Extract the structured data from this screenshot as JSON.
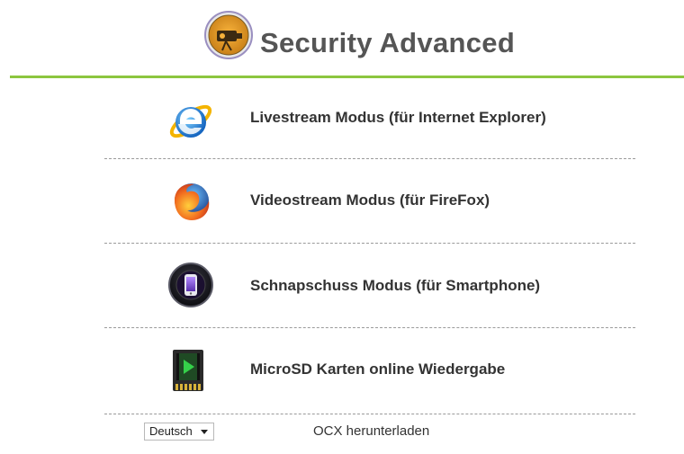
{
  "header": {
    "title": "Security Advanced",
    "logo_icon": "camera-logo-icon"
  },
  "menu": {
    "items": [
      {
        "label": "Livestream Modus (für Internet Explorer)",
        "icon": "internet-explorer-icon"
      },
      {
        "label": "Videostream Modus (für FireFox)",
        "icon": "firefox-icon"
      },
      {
        "label": "Schnapschuss Modus (für Smartphone)",
        "icon": "smartphone-icon"
      },
      {
        "label": "MicroSD Karten online Wiedergabe",
        "icon": "microsd-card-icon"
      }
    ]
  },
  "footer": {
    "language_selected": "Deutsch",
    "ocx_link": "OCX herunterladen"
  },
  "colors": {
    "accent_line": "#8cc63f",
    "title": "#555555",
    "label": "#333333"
  }
}
